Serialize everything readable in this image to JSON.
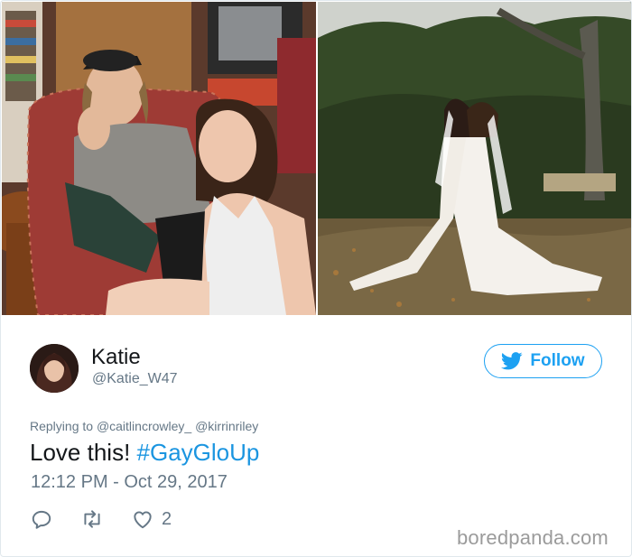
{
  "user": {
    "name": "Katie",
    "handle": "@Katie_W47"
  },
  "follow_button": {
    "label": "Follow"
  },
  "reply": {
    "prefix": "Replying to",
    "mention1": "@caitlincrowley_",
    "mention2": "@kirrinriley"
  },
  "tweet": {
    "text": "Love this!",
    "hashtag": "#GayGloUp",
    "timestamp": "12:12 PM - Oct 29, 2017"
  },
  "actions": {
    "like_count": "2",
    "reply_icon": "reply-icon",
    "retweet_icon": "retweet-icon",
    "like_icon": "heart-icon"
  },
  "watermark": "boredpanda.com",
  "colors": {
    "twitter_blue": "#1da1f2",
    "hashtag_blue": "#1b95e0",
    "secondary_text": "#657786"
  }
}
